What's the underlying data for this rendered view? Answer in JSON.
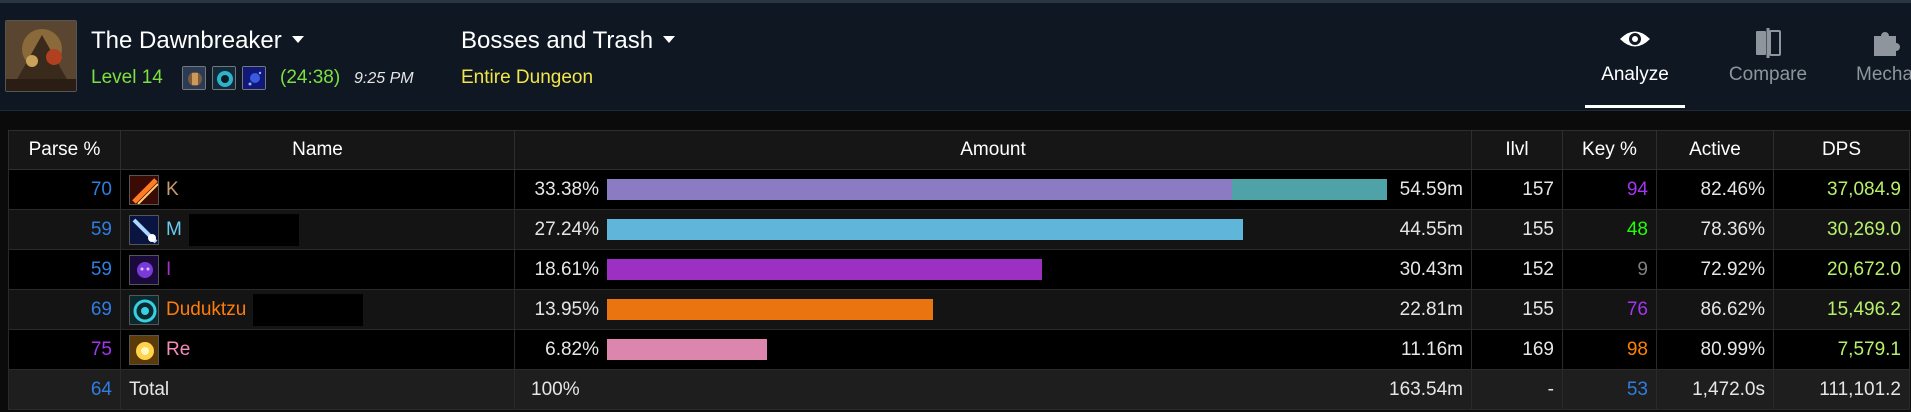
{
  "header": {
    "dungeon_title": "The Dawnbreaker",
    "level_text": "Level 14",
    "key_time": "(24:38)",
    "clock_time": "9:25 PM",
    "fight_select": "Bosses and Trash",
    "scope": "Entire Dungeon"
  },
  "nav": {
    "analyze": "Analyze",
    "compare": "Compare",
    "mechanics": "Mechanics"
  },
  "table": {
    "columns": [
      "Parse %",
      "Name",
      "Amount",
      "Ilvl",
      "Key %",
      "Active",
      "DPS"
    ],
    "rows": [
      {
        "parse": "70",
        "name": "K",
        "name_color": "#c79c6e",
        "pct": "33.38%",
        "share": 0.8008,
        "overlay_share": 0.1992,
        "bar_color": "#8b7bc2",
        "overlay_color": "#4fa3a8",
        "amount": "54.59m",
        "ilvl": "157",
        "key": "94",
        "key_color": "#a335ee",
        "active": "82.46%",
        "dps": "37,084.9",
        "icon": "fire-slash-icon"
      },
      {
        "parse": "59",
        "name": "M",
        "name_color": "#69ccf0",
        "pct": "27.24%",
        "share": 0.816,
        "overlay_share": 0,
        "bar_color": "#5fb6da",
        "overlay_color": "",
        "amount": "44.55m",
        "ilvl": "155",
        "key": "48",
        "key_color": "#1eff00",
        "active": "78.36%",
        "dps": "30,269.0",
        "icon": "frost-lance-icon"
      },
      {
        "parse": "59",
        "name": "I",
        "name_color": "#a330c9",
        "pct": "18.61%",
        "share": 0.5575,
        "overlay_share": 0,
        "bar_color": "#9b30c2",
        "overlay_color": "",
        "amount": "30.43m",
        "ilvl": "152",
        "key": "9",
        "key_color": "#7f7f7f",
        "active": "72.92%",
        "dps": "20,672.0",
        "icon": "demon-hunter-icon"
      },
      {
        "parse": "69",
        "name": "Duduktzu",
        "name_color": "#ff7c0a",
        "pct": "13.95%",
        "share": 0.418,
        "overlay_share": 0,
        "bar_color": "#ea7410",
        "overlay_color": "",
        "amount": "22.81m",
        "ilvl": "155",
        "key": "76",
        "key_color": "#a335ee",
        "active": "86.62%",
        "dps": "15,496.2",
        "icon": "feral-druid-icon"
      },
      {
        "parse": "75",
        "name": "Re",
        "name_color": "#f48cba",
        "pct": "6.82%",
        "share": 0.2045,
        "overlay_share": 0,
        "bar_color": "#dc86ad",
        "overlay_color": "",
        "amount": "11.16m",
        "ilvl": "169",
        "key": "98",
        "key_color": "#ff8000",
        "active": "80.99%",
        "dps": "7,579.1",
        "icon": "holy-light-icon"
      }
    ],
    "total": {
      "parse": "64",
      "name": "Total",
      "pct": "100%",
      "amount": "163.54m",
      "ilvl": "-",
      "key": "53",
      "key_color": "#2f7de1",
      "active": "1,472.0s",
      "dps": "111,101.2"
    }
  }
}
